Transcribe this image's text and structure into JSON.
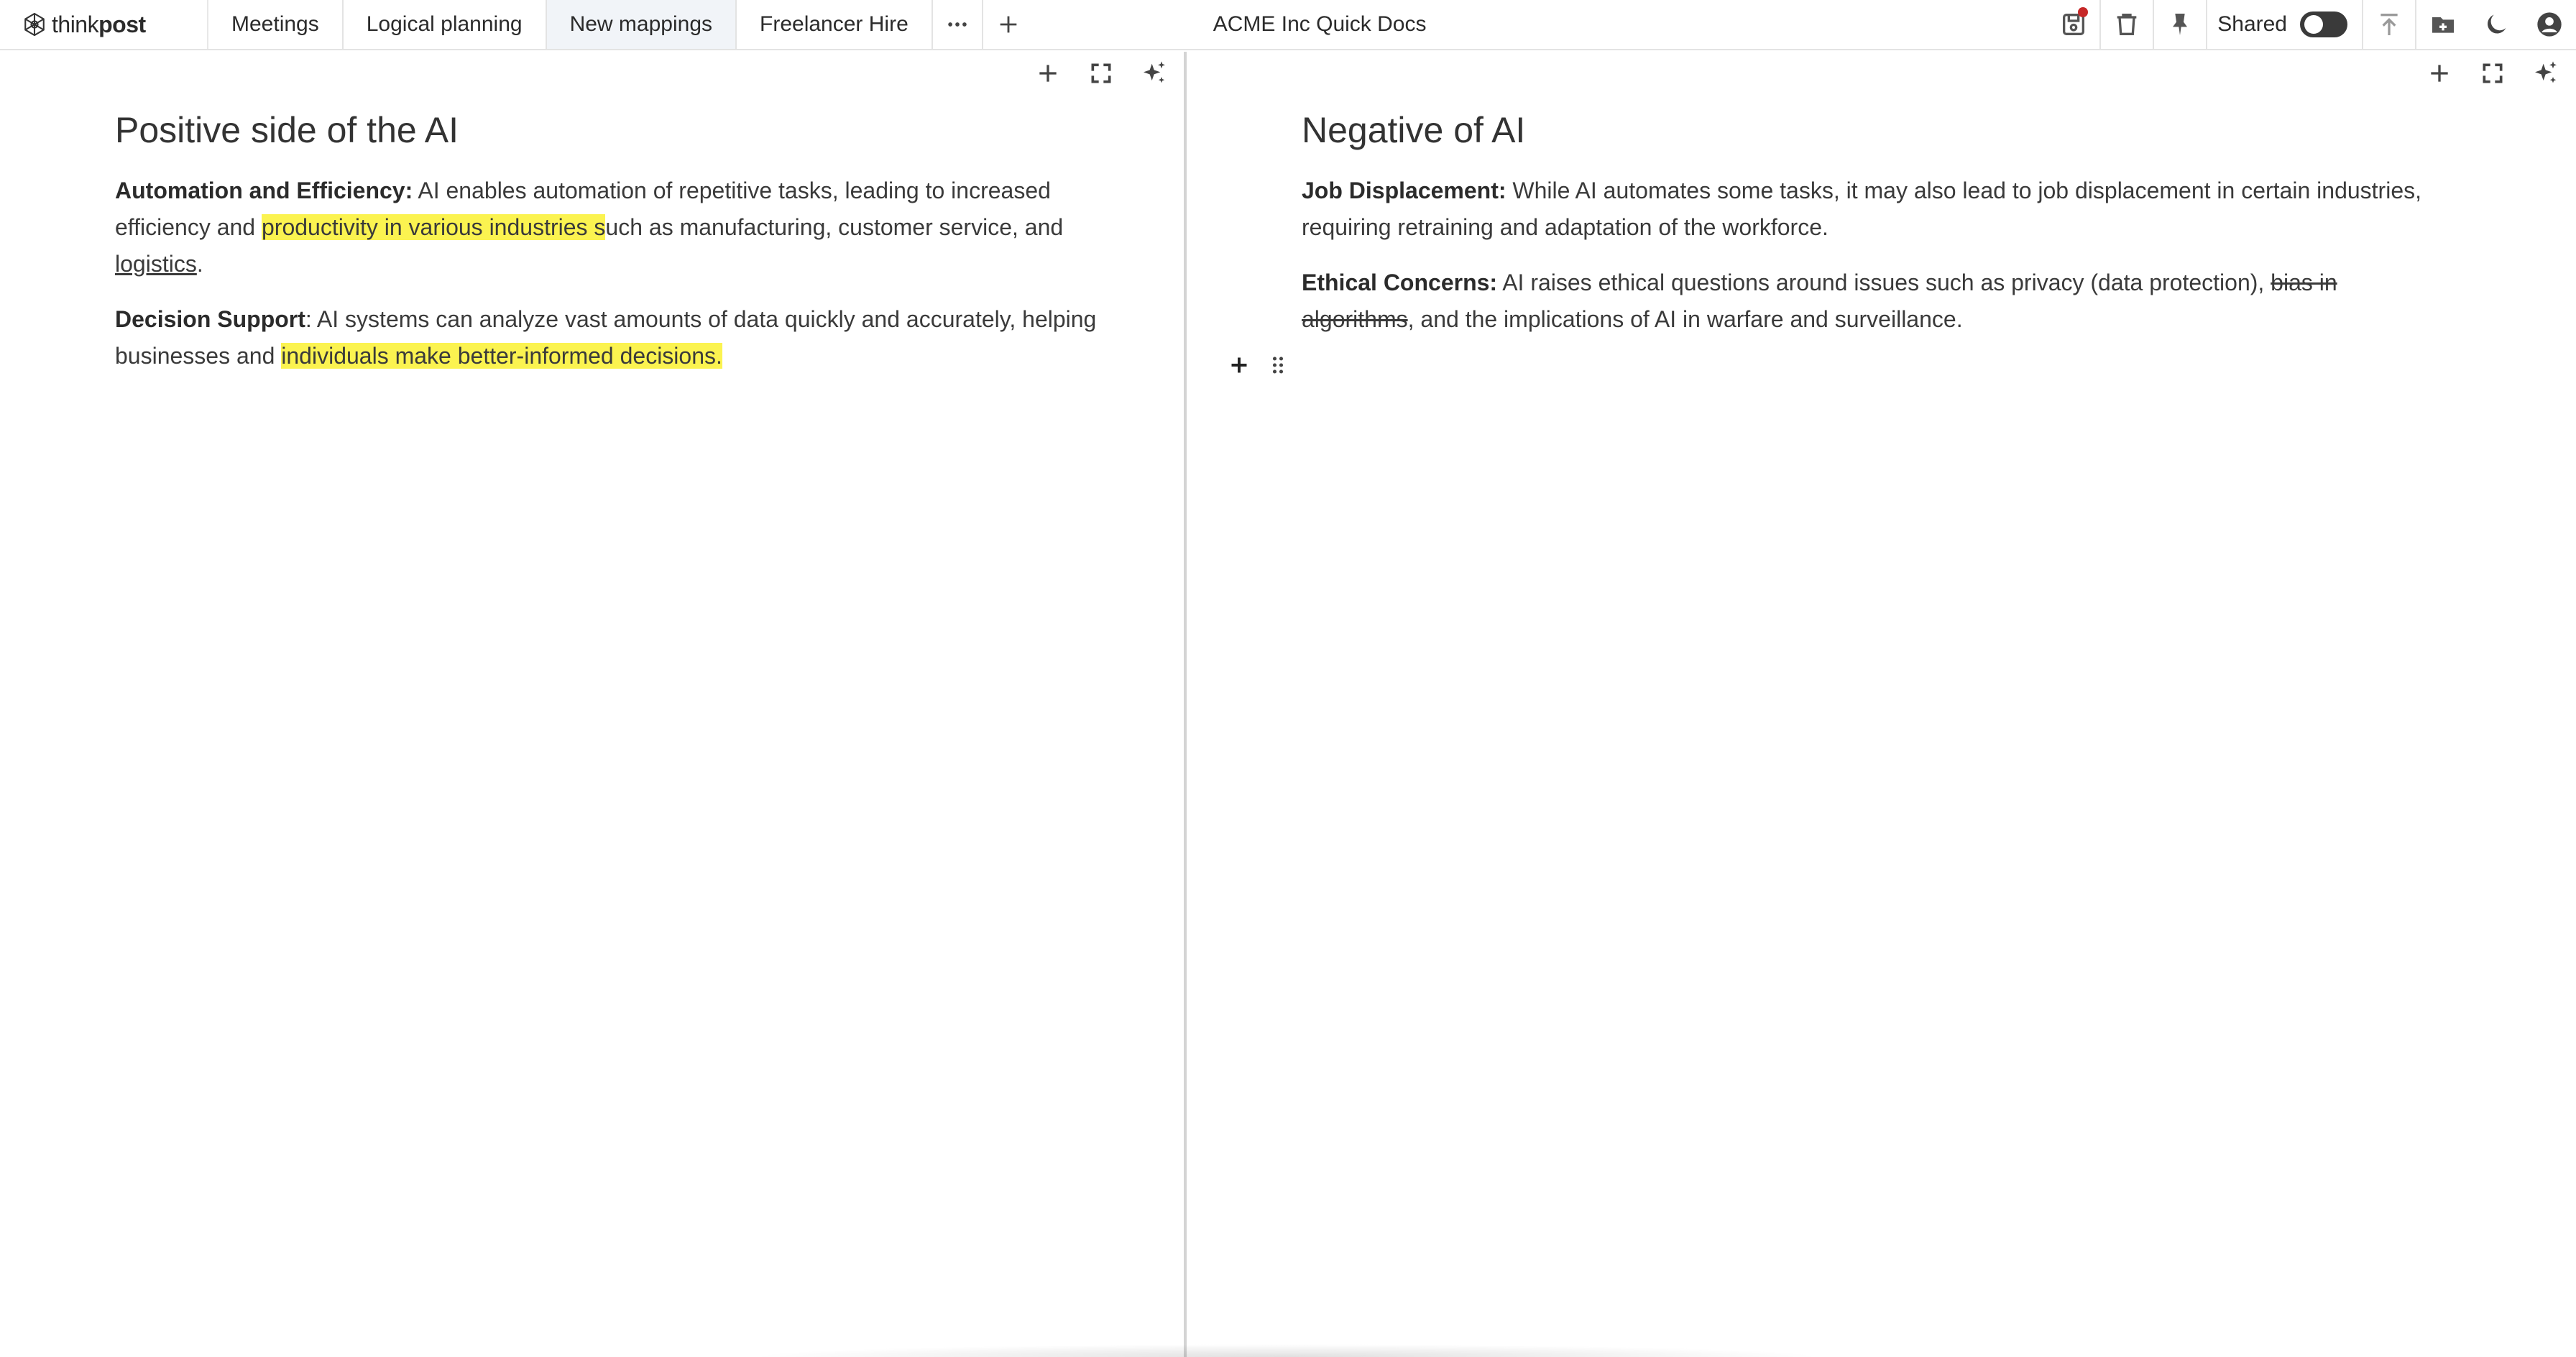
{
  "app": {
    "logo_light": "think",
    "logo_bold": "post",
    "doc_title": "ACME Inc Quick Docs"
  },
  "tabs": [
    {
      "label": "Meetings",
      "active": false
    },
    {
      "label": "Logical planning",
      "active": false
    },
    {
      "label": "New mappings",
      "active": true
    },
    {
      "label": "Freelancer Hire",
      "active": false
    }
  ],
  "toolbar": {
    "shared_label": "Shared",
    "shared_enabled": false,
    "icons": [
      "save-icon",
      "trash-icon",
      "pin-icon",
      "upload-icon",
      "new-folder-icon",
      "moon-icon",
      "account-icon"
    ],
    "notification_color": "#c62828"
  },
  "left_doc": {
    "title": "Positive side of the AI",
    "p1": {
      "label": "Automation and Efficiency:",
      "text_a": " AI enables automation of repetitive tasks, leading to increased efficiency and ",
      "highlight": "productivity in various industries s",
      "text_b": "uch as manufacturing, customer service, and ",
      "underline": "logistics",
      "text_c": "."
    },
    "p2": {
      "label": "Decision Support",
      "text_a": ": AI systems can analyze vast amounts of data quickly and accurately, helping businesses and ",
      "highlight": "individuals make better-informed decisions."
    }
  },
  "right_doc": {
    "title": "Negative of AI",
    "p1": {
      "label": "Job Displacement:",
      "text_a": " While AI automates some tasks, it may also lead to job displacement in certain industries, requiring retraining and adaptation of the workforce."
    },
    "p2": {
      "label": "Ethical Concerns:",
      "text_a": " AI raises ethical questions around issues such as privacy (data protection), ",
      "strike": "bias in algorithms",
      "text_b": ", and the implications of AI in warfare and surveillance."
    }
  },
  "colors": {
    "highlight": "#fbf350",
    "active_tab": "#f1f4f8"
  }
}
